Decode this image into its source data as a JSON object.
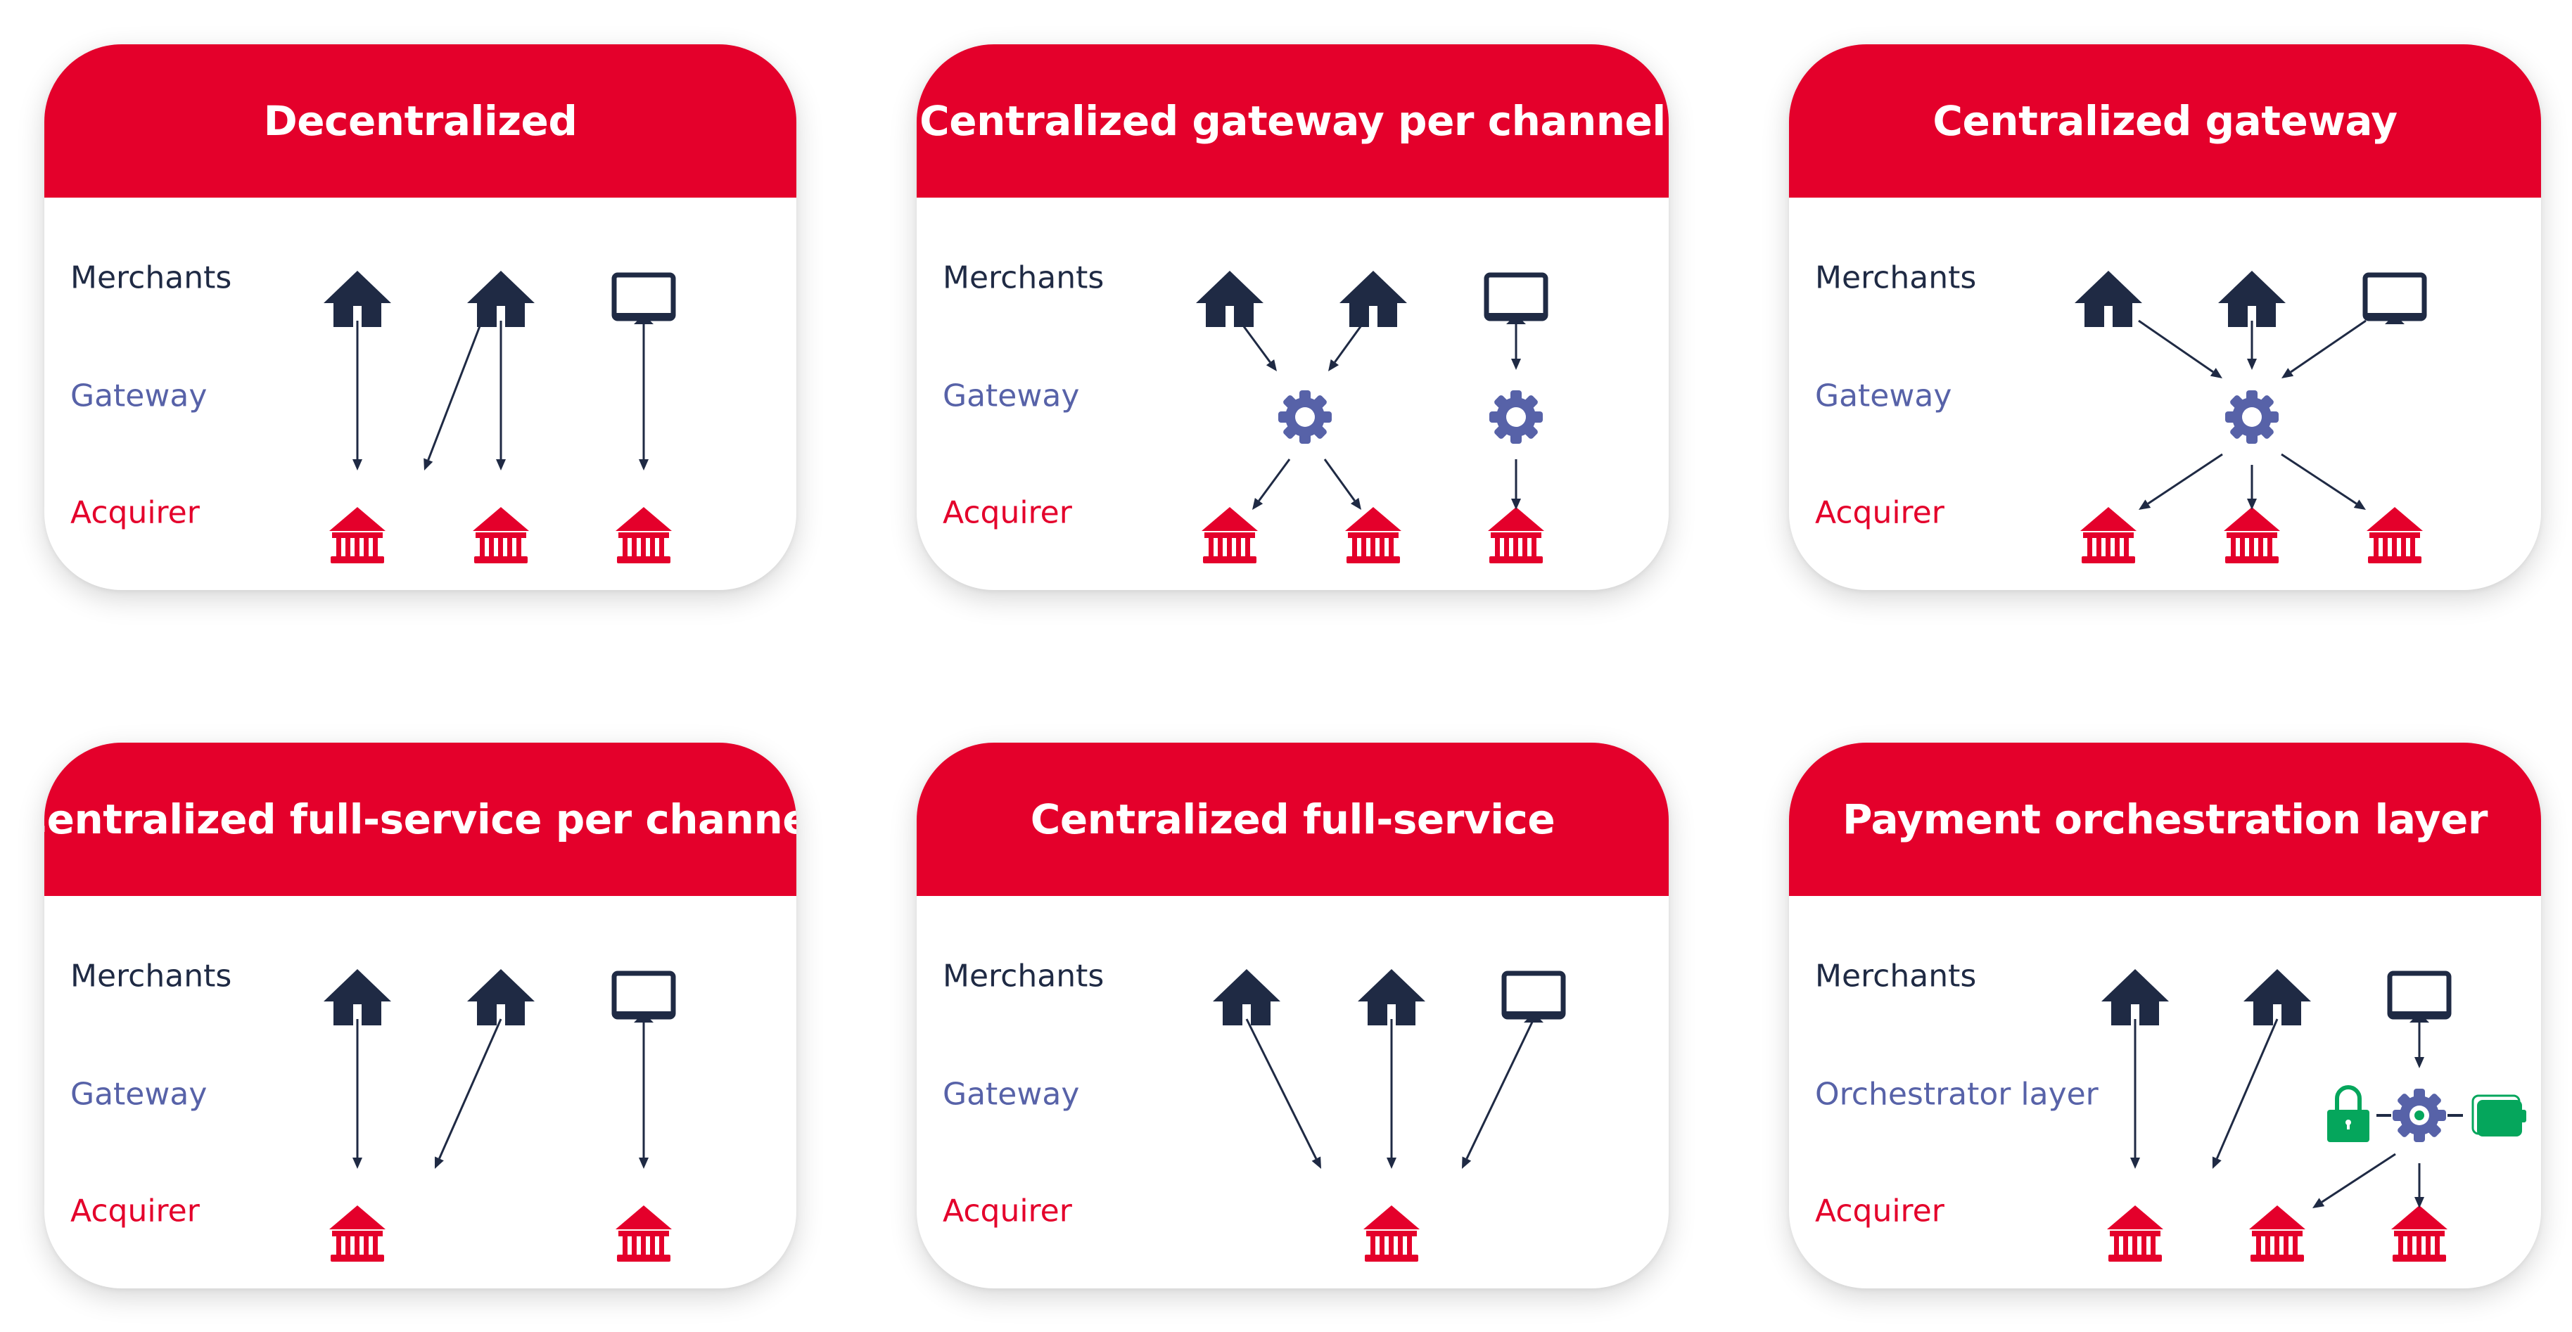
{
  "colors": {
    "header_red": "#e4002b",
    "merchant_navy": "#1f2a44",
    "gateway_blue": "#5762a8",
    "acquirer_red": "#e4002b",
    "orchestrator_green": "#05a65c"
  },
  "cards": [
    {
      "title": "Decentralized",
      "rows": {
        "merchants": "Merchants",
        "middle": "Gateway",
        "acquirer": "Acquirer"
      },
      "merchants": [
        "house-icon",
        "house-icon",
        "monitor-icon"
      ],
      "gateways": [],
      "acquirers": [
        "bank-icon",
        "bank-icon",
        "bank-icon"
      ],
      "flows": [
        "merchant 1 → acquirer 1",
        "merchant 2 → acquirer 1",
        "merchant 2 → acquirer 2",
        "merchant 3 → acquirer 3"
      ]
    },
    {
      "title": "Centralized gateway per channel",
      "rows": {
        "merchants": "Merchants",
        "middle": "Gateway",
        "acquirer": "Acquirer"
      },
      "merchants": [
        "house-icon",
        "house-icon",
        "monitor-icon"
      ],
      "gateways": [
        "gear-icon",
        "gear-icon"
      ],
      "acquirers": [
        "bank-icon",
        "bank-icon",
        "bank-icon"
      ],
      "flows": [
        "merchant 1 → gateway 1",
        "merchant 2 → gateway 1",
        "merchant 3 → gateway 2",
        "gateway 1 → acquirer 1",
        "gateway 1 → acquirer 2",
        "gateway 2 → acquirer 3"
      ]
    },
    {
      "title": "Centralized gateway",
      "rows": {
        "merchants": "Merchants",
        "middle": "Gateway",
        "acquirer": "Acquirer"
      },
      "merchants": [
        "house-icon",
        "house-icon",
        "monitor-icon"
      ],
      "gateways": [
        "gear-icon"
      ],
      "acquirers": [
        "bank-icon",
        "bank-icon",
        "bank-icon"
      ],
      "flows": [
        "merchant 1 → gateway",
        "merchant 2 → gateway",
        "merchant 3 → gateway",
        "gateway → acquirer 1",
        "gateway → acquirer 2",
        "gateway → acquirer 3"
      ]
    },
    {
      "title": "Centralized full-service per channel",
      "rows": {
        "merchants": "Merchants",
        "middle": "Gateway",
        "acquirer": "Acquirer"
      },
      "merchants": [
        "house-icon",
        "house-icon",
        "monitor-icon"
      ],
      "gateways": [],
      "acquirers": [
        "bank-icon",
        "bank-icon"
      ],
      "flows": [
        "merchant 1 → acquirer 1",
        "merchant 2 → acquirer 1",
        "merchant 3 → acquirer 2"
      ]
    },
    {
      "title": "Centralized full-service",
      "rows": {
        "merchants": "Merchants",
        "middle": "Gateway",
        "acquirer": "Acquirer"
      },
      "merchants": [
        "house-icon",
        "house-icon",
        "monitor-icon"
      ],
      "gateways": [],
      "acquirers": [
        "bank-icon"
      ],
      "flows": [
        "merchant 1 → acquirer",
        "merchant 2 → acquirer",
        "merchant 3 → acquirer"
      ]
    },
    {
      "title": "Payment orchestration layer",
      "rows": {
        "merchants": "Merchants",
        "middle": "Orchestrator layer",
        "acquirer": "Acquirer"
      },
      "merchants": [
        "house-icon",
        "house-icon",
        "monitor-icon"
      ],
      "gateways": [
        "lock-icon",
        "gear-icon",
        "wallet-icon"
      ],
      "acquirers": [
        "bank-icon",
        "bank-icon",
        "bank-icon"
      ],
      "flows": [
        "merchant 1 → acquirer 1",
        "merchant 2 → acquirer 2",
        "merchant 3 → orchestrator",
        "orchestrator → acquirer 2",
        "orchestrator → acquirer 3"
      ]
    }
  ]
}
